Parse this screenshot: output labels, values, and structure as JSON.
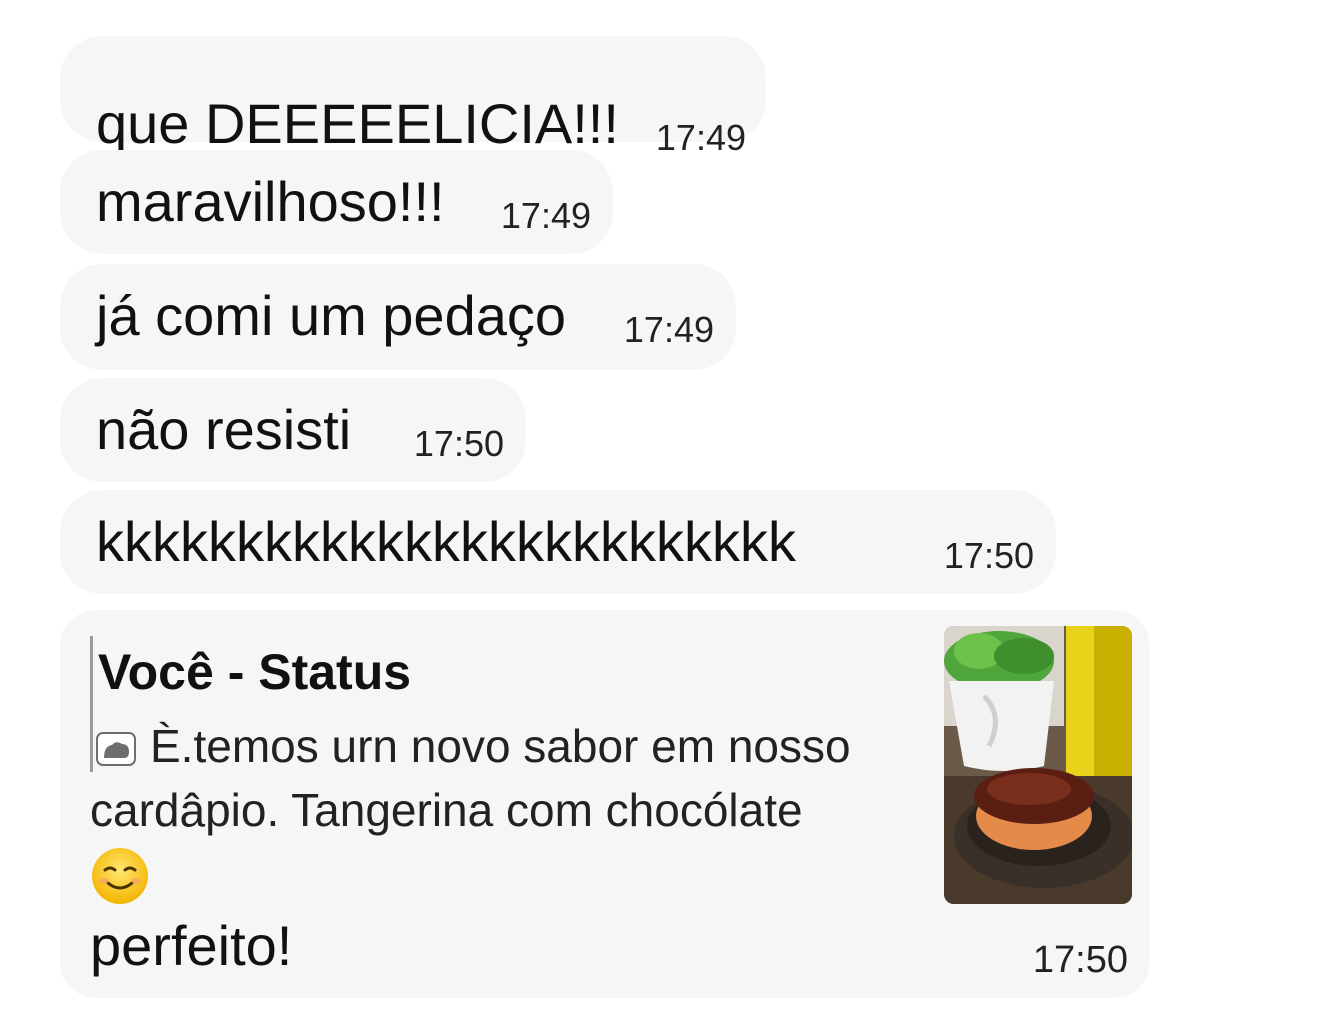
{
  "messages": [
    {
      "text": "que DEEEEELICIA!!!",
      "time": "17:49"
    },
    {
      "text": "maravilhoso!!!",
      "time": "17:49"
    },
    {
      "text": "já comi um pedaço",
      "time": "17:49"
    },
    {
      "text": "não resisti",
      "time": "17:50"
    },
    {
      "text": "kkkkkkkkkkkkkkkkkkkkkkkkk",
      "time": "17:50"
    }
  ],
  "reply_message": {
    "quote": {
      "author": "Você - Status",
      "media_icon": "photo-icon",
      "text_line1": "È.temos  urn novo sabor em nosso",
      "text_line2": "cardâpio. Tangerina com chocólate",
      "emoji": "smiling-face-icon",
      "thumbnail": "cake-photo-thumbnail"
    },
    "text": "perfeito!",
    "time": "17:50"
  },
  "colors": {
    "bubble_bg": "#f6f6f6",
    "page_bg": "#ffffff",
    "quote_bar": "#9a9a9a"
  }
}
